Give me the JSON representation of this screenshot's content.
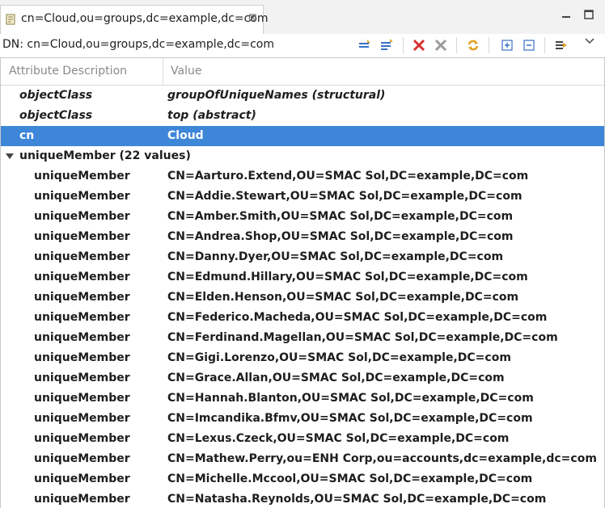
{
  "tab": {
    "title": "cn=Cloud,ou=groups,dc=example,dc=com",
    "close": "⊠"
  },
  "dn_bar": {
    "text": "DN: cn=Cloud,ou=groups,dc=example,dc=com"
  },
  "colors": {
    "selection": "#3d86d8",
    "delete_red": "#d83030",
    "accent_blue": "#3a6fc4",
    "refresh_orange": "#e0a020"
  },
  "grid": {
    "headers": {
      "attribute": "Attribute Description",
      "value": "Value"
    },
    "rows": [
      {
        "attribute": "objectClass",
        "value": "groupOfUniqueNames (structural)",
        "style": "italic"
      },
      {
        "attribute": "objectClass",
        "value": "top (abstract)",
        "style": "italic"
      },
      {
        "attribute": "cn",
        "value": "Cloud",
        "style": "selected"
      },
      {
        "attribute": "uniqueMember (22 values)",
        "value": "",
        "style": "group"
      },
      {
        "attribute": "uniqueMember",
        "value": "CN=Aarturo.Extend,OU=SMAC Sol,DC=example,DC=com",
        "style": "child"
      },
      {
        "attribute": "uniqueMember",
        "value": "CN=Addie.Stewart,OU=SMAC Sol,DC=example,DC=com",
        "style": "child"
      },
      {
        "attribute": "uniqueMember",
        "value": "CN=Amber.Smith,OU=SMAC Sol,DC=example,DC=com",
        "style": "child"
      },
      {
        "attribute": "uniqueMember",
        "value": "CN=Andrea.Shop,OU=SMAC Sol,DC=example,DC=com",
        "style": "child"
      },
      {
        "attribute": "uniqueMember",
        "value": "CN=Danny.Dyer,OU=SMAC Sol,DC=example,DC=com",
        "style": "child"
      },
      {
        "attribute": "uniqueMember",
        "value": "CN=Edmund.Hillary,OU=SMAC Sol,DC=example,DC=com",
        "style": "child"
      },
      {
        "attribute": "uniqueMember",
        "value": "CN=Elden.Henson,OU=SMAC Sol,DC=example,DC=com",
        "style": "child"
      },
      {
        "attribute": "uniqueMember",
        "value": "CN=Federico.Macheda,OU=SMAC Sol,DC=example,DC=com",
        "style": "child"
      },
      {
        "attribute": "uniqueMember",
        "value": "CN=Ferdinand.Magellan,OU=SMAC Sol,DC=example,DC=com",
        "style": "child"
      },
      {
        "attribute": "uniqueMember",
        "value": "CN=Gigi.Lorenzo,OU=SMAC Sol,DC=example,DC=com",
        "style": "child"
      },
      {
        "attribute": "uniqueMember",
        "value": "CN=Grace.Allan,OU=SMAC Sol,DC=example,DC=com",
        "style": "child"
      },
      {
        "attribute": "uniqueMember",
        "value": "CN=Hannah.Blanton,OU=SMAC Sol,DC=example,DC=com",
        "style": "child"
      },
      {
        "attribute": "uniqueMember",
        "value": "CN=Imcandika.Bfmv,OU=SMAC Sol,DC=example,DC=com",
        "style": "child"
      },
      {
        "attribute": "uniqueMember",
        "value": "CN=Lexus.Czeck,OU=SMAC Sol,DC=example,DC=com",
        "style": "child"
      },
      {
        "attribute": "uniqueMember",
        "value": "CN=Mathew.Perry,ou=ENH Corp,ou=accounts,dc=example,dc=com",
        "style": "child"
      },
      {
        "attribute": "uniqueMember",
        "value": "CN=Michelle.Mccool,OU=SMAC Sol,DC=example,DC=com",
        "style": "child"
      },
      {
        "attribute": "uniqueMember",
        "value": "CN=Natasha.Reynolds,OU=SMAC Sol,DC=example,DC=com",
        "style": "child"
      }
    ]
  }
}
